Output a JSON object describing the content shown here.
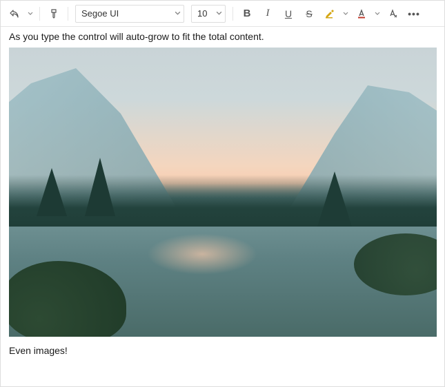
{
  "toolbar": {
    "font_family": "Segoe UI",
    "font_size": "10"
  },
  "body": {
    "line1": "As you type the control will auto-grow to fit the total content.",
    "line2": "Even images!"
  }
}
